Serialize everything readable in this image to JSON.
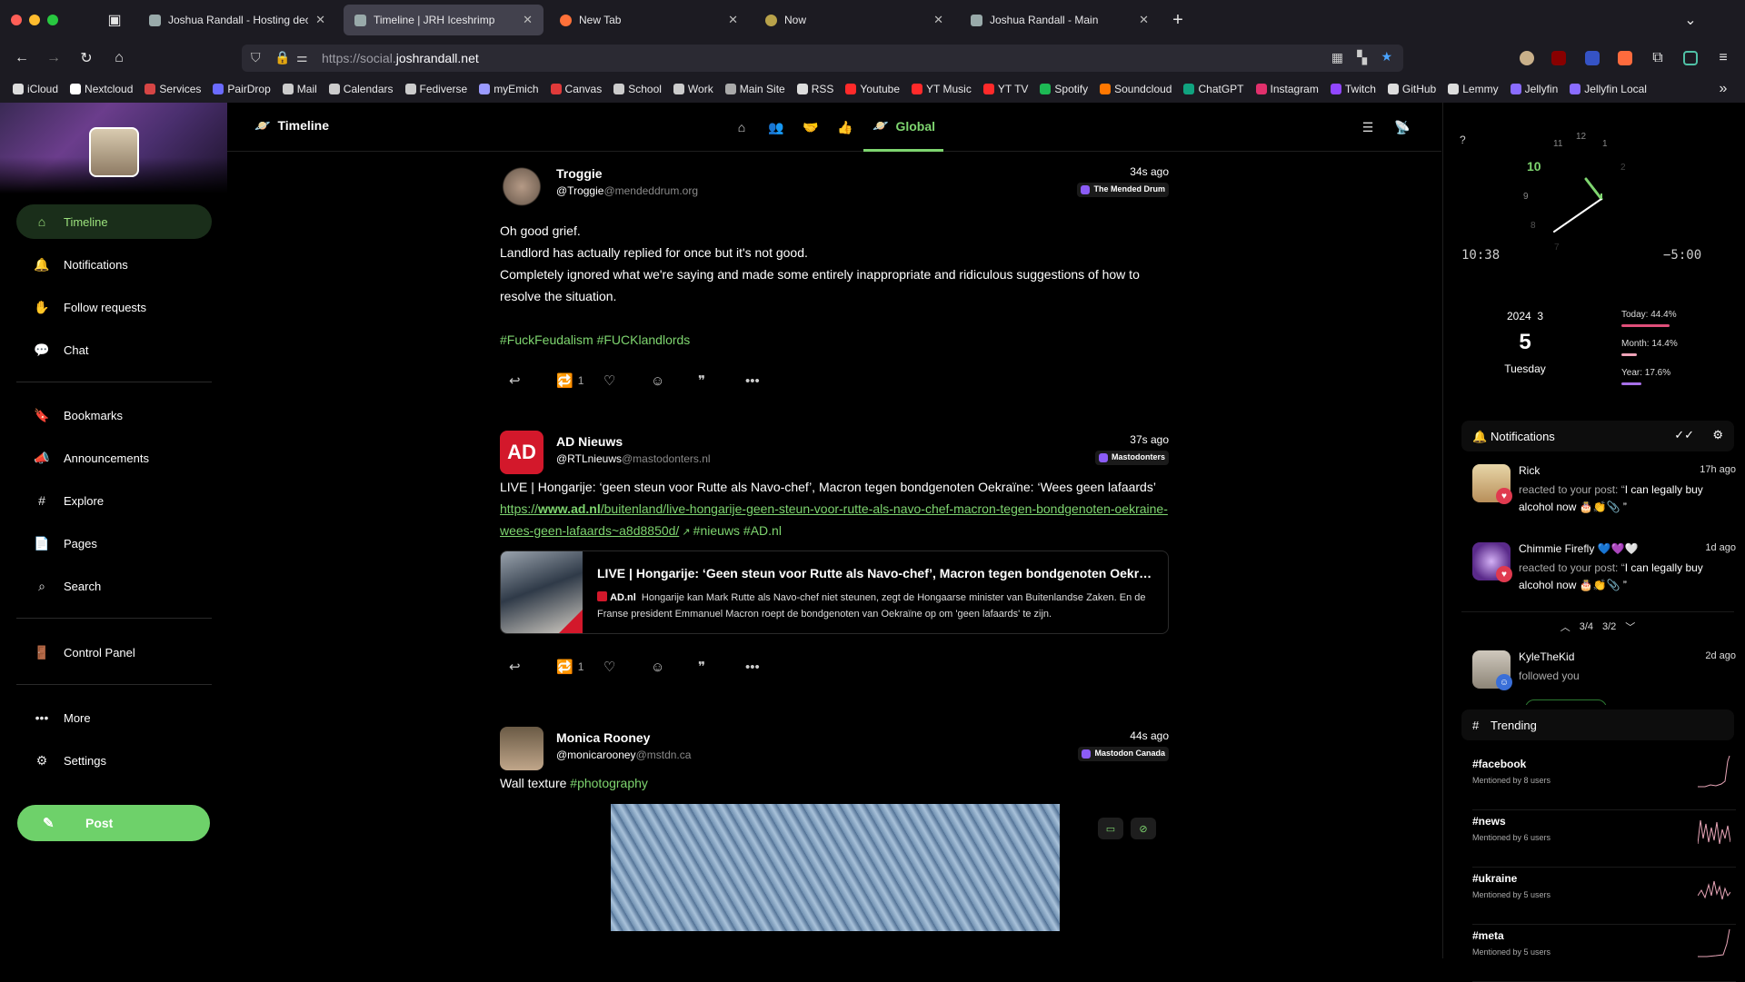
{
  "browser": {
    "tabs": [
      {
        "title": "Joshua Randall - Hosting decen",
        "fav_color": "#9aa"
      },
      {
        "title": "Timeline | JRH Iceshrimp",
        "fav_color": "#9aa"
      },
      {
        "title": "New Tab",
        "fav_color": "#ff7139"
      },
      {
        "title": "Now",
        "fav_color": "#b8a24a"
      },
      {
        "title": "Joshua Randall - Main",
        "fav_color": "#9aa"
      }
    ],
    "url_prefix": "https://social.",
    "url_domain": "joshrandall.net",
    "bookmarks": [
      {
        "label": "iCloud",
        "color": "#ddd"
      },
      {
        "label": "Nextcloud",
        "color": "#fff"
      },
      {
        "label": "Services",
        "color": "#d64545"
      },
      {
        "label": "PairDrop",
        "color": "#6b6bff"
      },
      {
        "label": "Mail",
        "color": "#ccc"
      },
      {
        "label": "Calendars",
        "color": "#ccc"
      },
      {
        "label": "Fediverse",
        "color": "#ccc"
      },
      {
        "label": "myEmich",
        "color": "#9a9aff"
      },
      {
        "label": "Canvas",
        "color": "#e03a3a"
      },
      {
        "label": "School",
        "color": "#ccc"
      },
      {
        "label": "Work",
        "color": "#ccc"
      },
      {
        "label": "Main Site",
        "color": "#aaa"
      },
      {
        "label": "RSS",
        "color": "#ddd"
      },
      {
        "label": "Youtube",
        "color": "#ff2a2a"
      },
      {
        "label": "YT Music",
        "color": "#ff2a2a"
      },
      {
        "label": "YT TV",
        "color": "#ff2a2a"
      },
      {
        "label": "Spotify",
        "color": "#1db954"
      },
      {
        "label": "Soundcloud",
        "color": "#ff7700"
      },
      {
        "label": "ChatGPT",
        "color": "#10a37f"
      },
      {
        "label": "Instagram",
        "color": "#e1306c"
      },
      {
        "label": "Twitch",
        "color": "#9146ff"
      },
      {
        "label": "GitHub",
        "color": "#ddd"
      },
      {
        "label": "Lemmy",
        "color": "#ddd"
      },
      {
        "label": "Jellyfin",
        "color": "#8a6cff"
      },
      {
        "label": "Jellyfin Local",
        "color": "#8a6cff"
      }
    ]
  },
  "sidebar": {
    "items": [
      {
        "label": "Timeline",
        "icon": "home-icon",
        "glyph": "⌂"
      },
      {
        "label": "Notifications",
        "icon": "bell-icon",
        "glyph": "🔔"
      },
      {
        "label": "Follow requests",
        "icon": "hand-wave-icon",
        "glyph": "✋"
      },
      {
        "label": "Chat",
        "icon": "chat-icon",
        "glyph": "💬"
      },
      {
        "label": "Bookmarks",
        "icon": "bookmark-icon",
        "glyph": "🔖"
      },
      {
        "label": "Announcements",
        "icon": "megaphone-icon",
        "glyph": "📣"
      },
      {
        "label": "Explore",
        "icon": "hash-icon",
        "glyph": "#"
      },
      {
        "label": "Pages",
        "icon": "page-icon",
        "glyph": "📄"
      },
      {
        "label": "Search",
        "icon": "search-icon",
        "glyph": "⌕"
      },
      {
        "label": "Control Panel",
        "icon": "door-icon",
        "glyph": "🚪"
      },
      {
        "label": "More",
        "icon": "dots-icon",
        "glyph": "•••"
      },
      {
        "label": "Settings",
        "icon": "gear-icon",
        "glyph": "⚙"
      }
    ],
    "post_label": "Post"
  },
  "header": {
    "title": "Timeline",
    "active_tab": "Global"
  },
  "notes": [
    {
      "name": "Troggie",
      "user": "@Troggie",
      "host": "@mendeddrum.org",
      "time": "34s ago",
      "instance": "The Mended Drum",
      "lines": [
        "Oh good grief.",
        "Landlord has actually replied for once but it's not good.",
        "Completely ignored what we're saying and made some entirely inappropriate and ridiculous suggestions of how to resolve the situation."
      ],
      "tags": "#FuckFeudalism #FUCKlandlords",
      "renote_count": "1"
    },
    {
      "name": "AD Nieuws",
      "user": "@RTLnieuws",
      "host": "@mastodonters.nl",
      "time": "37s ago",
      "instance": "Mastodonters",
      "text": "LIVE | Hongarije: ‘geen steun voor Rutte als Navo-chef’, Macron tegen bondgenoten Oekraïne: ‘Wees geen lafaards’",
      "link_prefix": "https://",
      "link_domain": "www.ad.nl",
      "link_path": "/buitenland/live-hongarije-geen-steun-voor-rutte-als-navo-chef-macron-tegen-bondgenoten-oekraine-wees-geen-lafaards~a8d8850d/",
      "tags": "#nieuws #AD.nl",
      "card_title": "LIVE | Hongarije: ‘Geen steun voor Rutte als Navo-chef’, Macron tegen bondgenoten Oekraïne: ‘Wees geen lafaards’",
      "card_site": "AD.nl",
      "card_desc": "Hongarije kan Mark Rutte als Navo-chef niet steunen, zegt de Hongaarse minister van Buitenlandse Zaken. En de Franse president Emmanuel Macron roept de bondgenoten van Oekraïne op om 'geen lafaards' te zijn.",
      "renote_count": "1"
    },
    {
      "name": "Monica Rooney",
      "user": "@monicarooney",
      "host": "@mstdn.ca",
      "time": "44s ago",
      "instance": "Mastodon Canada",
      "text": "Wall texture",
      "tag": "#photography"
    }
  ],
  "widgets": {
    "clock": {
      "q": "?",
      "hour_highlight": "10",
      "n12": "12",
      "n11": "11",
      "n1": "1",
      "n2": "2",
      "n9": "9",
      "n8": "8",
      "n7": "7",
      "time": "10:38",
      "offset": "−5:00"
    },
    "date": {
      "year": "2024",
      "month": "3",
      "day": "5",
      "weekday": "Tuesday"
    },
    "progress": [
      {
        "label": "Today:",
        "value": "44.4%",
        "fraction": 0.444,
        "color": "#e04f7a"
      },
      {
        "label": "Month:",
        "value": "14.4%",
        "fraction": 0.144,
        "color": "#f0a3b8"
      },
      {
        "label": "Year:",
        "value": "17.6%",
        "fraction": 0.176,
        "color": "#a770e8"
      }
    ],
    "notifications_title": "Notifications",
    "notifications": [
      {
        "name": "Rick",
        "time": "17h ago",
        "action": "reacted to your post: “",
        "quote": "I can legally buy alcohol now 🎂👏📎 ”"
      },
      {
        "name": "Chimmie Firefly 💙💜🤍",
        "time": "1d ago",
        "action": "reacted to your post: “",
        "quote": "I can legally buy alcohol now 🎂👏📎 ”"
      },
      {
        "name": "KyleTheKid",
        "time": "2d ago",
        "action": "followed you",
        "quote": ""
      }
    ],
    "pager": {
      "left": "3/4",
      "right": "3/2"
    },
    "trending_title": "Trending",
    "trending": [
      {
        "tag": "#facebook",
        "sub": "Mentioned by 8 users"
      },
      {
        "tag": "#news",
        "sub": "Mentioned by 6 users"
      },
      {
        "tag": "#ukraine",
        "sub": "Mentioned by 5 users"
      },
      {
        "tag": "#meta",
        "sub": "Mentioned by 5 users"
      }
    ]
  }
}
